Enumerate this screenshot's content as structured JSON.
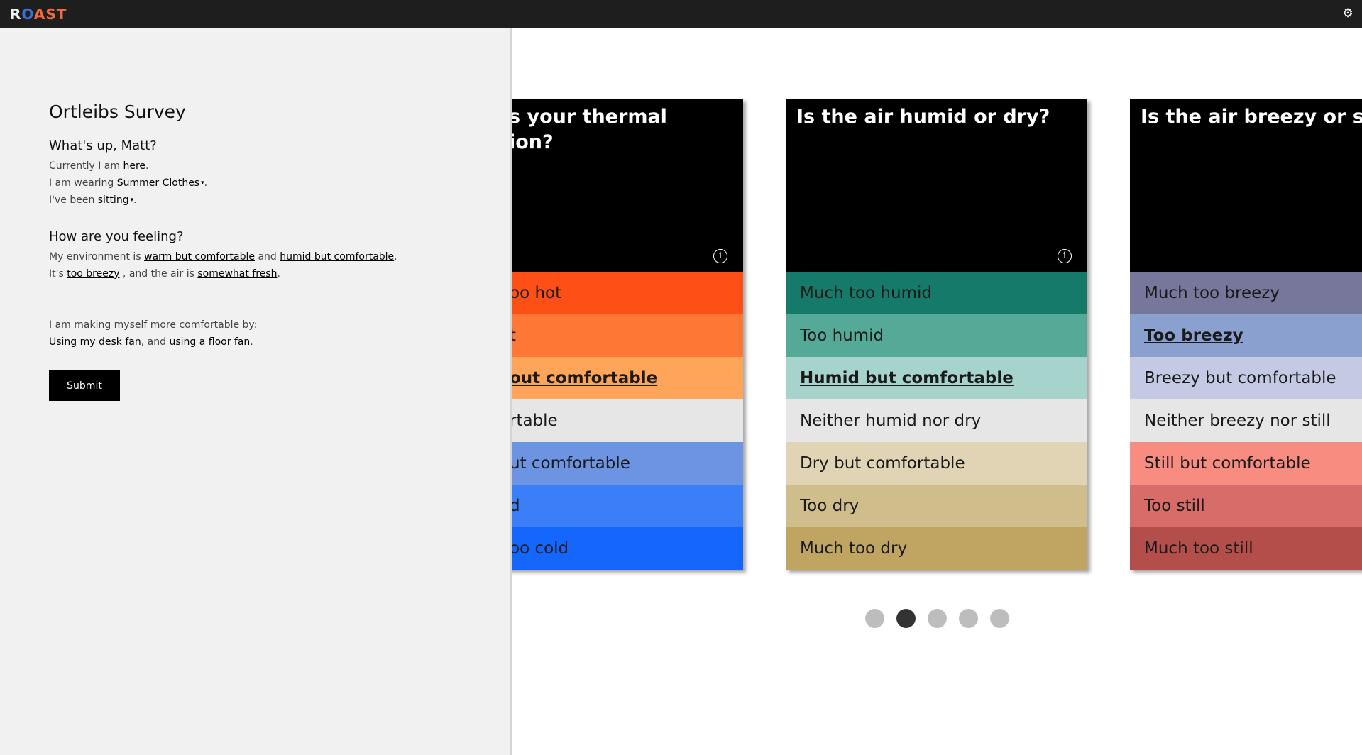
{
  "app": {
    "logo": "ROAST",
    "logo_r": "R",
    "logo_o": "O",
    "logo_rest": "AST",
    "settings_icon": "gear-icon"
  },
  "sidebar": {
    "title": "Ortleibs Survey",
    "greeting": "What's up, Matt?",
    "location": {
      "prefix": "Currently I am ",
      "link": "here",
      "suffix": "."
    },
    "clothing": {
      "prefix": "I am wearing ",
      "link": "Summer Clothes",
      "suffix": "."
    },
    "activity": {
      "prefix": "I've been ",
      "link": "sitting",
      "suffix": "."
    },
    "feeling_heading": "How are you feeling?",
    "env": {
      "prefix": "My environment is ",
      "thermal": "warm but comfortable",
      "mid": " and ",
      "humidity": "humid but comfortable",
      "suffix": "."
    },
    "air": {
      "prefix": "It's ",
      "breeze": "too breezy",
      "mid": " , and the air is ",
      "fresh": "somewhat fresh",
      "suffix": "."
    },
    "comfort_prompt": "I am making myself more comfortable by:",
    "comfort": {
      "action1": "Using my desk fan",
      "mid": ", and ",
      "action2": "using a floor fan",
      "suffix": "."
    },
    "submit_label": "Submit"
  },
  "cards": [
    {
      "question": "s your thermal\nion?",
      "options": [
        "oo hot",
        "t",
        "out comfortable",
        "rtable",
        "ut comfortable",
        "d",
        "oo cold"
      ],
      "colors": [
        "#fe5016",
        "#ff7735",
        "#ffa55a",
        "#e5e6e5",
        "#6d94e2",
        "#3c7ef8",
        "#1466fd"
      ],
      "selected_index": 2
    },
    {
      "question": "Is the air humid or dry?",
      "options": [
        "Much too humid",
        "Too humid",
        "Humid but comfortable",
        "Neither humid nor dry",
        "Dry but comfortable",
        "Too dry",
        "Much too dry"
      ],
      "colors": [
        "#157a6a",
        "#55a997",
        "#a6d4cd",
        "#e5e6e5",
        "#e0d4b5",
        "#cfbe8c",
        "#c0a562"
      ],
      "selected_index": 2
    },
    {
      "question": "Is the air breezy or still?",
      "options": [
        "Much too breezy",
        "Too breezy",
        "Breezy but comfortable",
        "Neither breezy nor still",
        "Still but comfortable",
        "Too still",
        "Much too still"
      ],
      "colors": [
        "#77779b",
        "#8aa0cf",
        "#c4cae3",
        "#e5e6e5",
        "#f98c81",
        "#d76c68",
        "#b34e4b"
      ],
      "selected_index": 1
    }
  ],
  "carousel": {
    "count": 5,
    "active_index": 1
  }
}
